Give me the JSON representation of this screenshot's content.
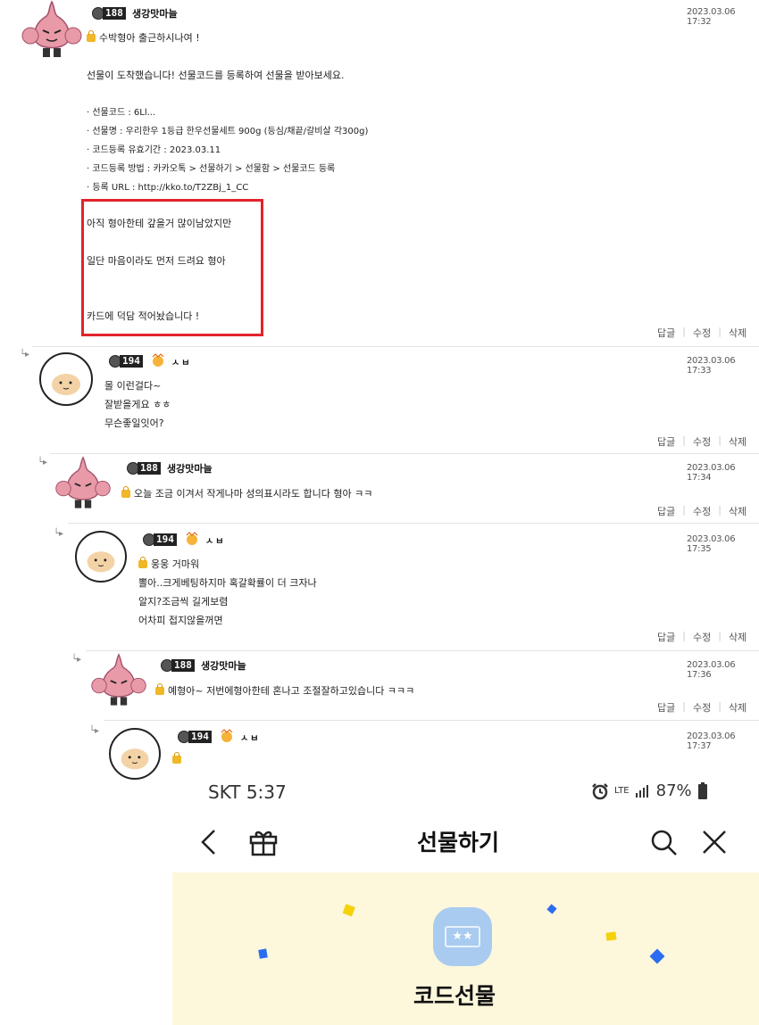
{
  "comments": [
    {
      "nickname": "생강맛마늘",
      "level": "188",
      "date": "2023.03.06 17:32",
      "lines": [
        "수박형아 출근하시나여 !",
        "",
        "선물이 도착했습니다! 선물코드를 등록하여 선물을 받아보세요.",
        "",
        "· 선물코드 : 6Ll...",
        "· 선물명 : 우리한우 1등급 한우선물세트 900g (등심/채끝/갈비살 각300g)",
        "· 코드등록 유효기간 : 2023.03.11",
        "· 코드등록 방법 : 카카오톡 > 선물하기 > 선물함 > 선물코드 등록",
        "· 등록 URL : http://kko.to/T2ZBj_1_CC",
        "",
        "아직 형아한테 갚을거 많이남았지만",
        "",
        "일단 마음이라도 먼저 드려요 형아",
        "",
        "",
        "카드에 덕담 적어놨습니다 !"
      ],
      "actions": [
        "답글",
        "수정",
        "삭제"
      ]
    },
    {
      "nickname": "ㅅㅂ",
      "level": "194",
      "date": "2023.03.06 17:33",
      "lines": [
        "몰 이런걸다~",
        "잘받을게요 ㅎㅎ",
        "무슨좋일잇어?"
      ],
      "actions": [
        "답글",
        "수정",
        "삭제"
      ]
    },
    {
      "nickname": "생강맛마늘",
      "level": "188",
      "date": "2023.03.06 17:34",
      "lines": [
        "오늘 조금 이겨서 작게나마 성의표시라도 합니다 형아 ㅋㅋ"
      ],
      "actions": [
        "답글",
        "수정",
        "삭제"
      ]
    },
    {
      "nickname": "ㅅㅂ",
      "level": "194",
      "date": "2023.03.06 17:35",
      "lines": [
        "웅웅 거마워",
        "뽈아..크게베팅하지마 혹갈확률이 더 크자나",
        "알지?조금씩 길게보렴",
        "어차피 접지않을꺼면"
      ],
      "actions": [
        "답글",
        "수정",
        "삭제"
      ]
    },
    {
      "nickname": "생강맛마늘",
      "level": "188",
      "date": "2023.03.06 17:36",
      "lines": [
        "예형아~ 저번에형아한테 혼나고 조절잘하고있습니다 ㅋㅋㅋ"
      ],
      "actions": [
        "답글",
        "수정",
        "삭제"
      ]
    },
    {
      "nickname": "ㅅㅂ",
      "level": "194",
      "date": "2023.03.06 17:37",
      "lines": [
        ""
      ],
      "actions": []
    }
  ],
  "phone": {
    "carrier_time": "SKT 5:37",
    "status_right": "87%",
    "network": "LTE",
    "nav_title": "선물하기",
    "banner_title": "코드선물",
    "gift_icon_text": "★★",
    "banner_color": "#fdf7dc",
    "icons": [
      "back-arrow-icon",
      "gift-icon",
      "search-icon",
      "close-icon",
      "alarm-icon",
      "signal-icon",
      "battery-icon"
    ]
  },
  "colors": {
    "highlight_box": "#e2232a",
    "confetti_yellow": "#f5d10a",
    "confetti_blue": "#2a6df0"
  }
}
